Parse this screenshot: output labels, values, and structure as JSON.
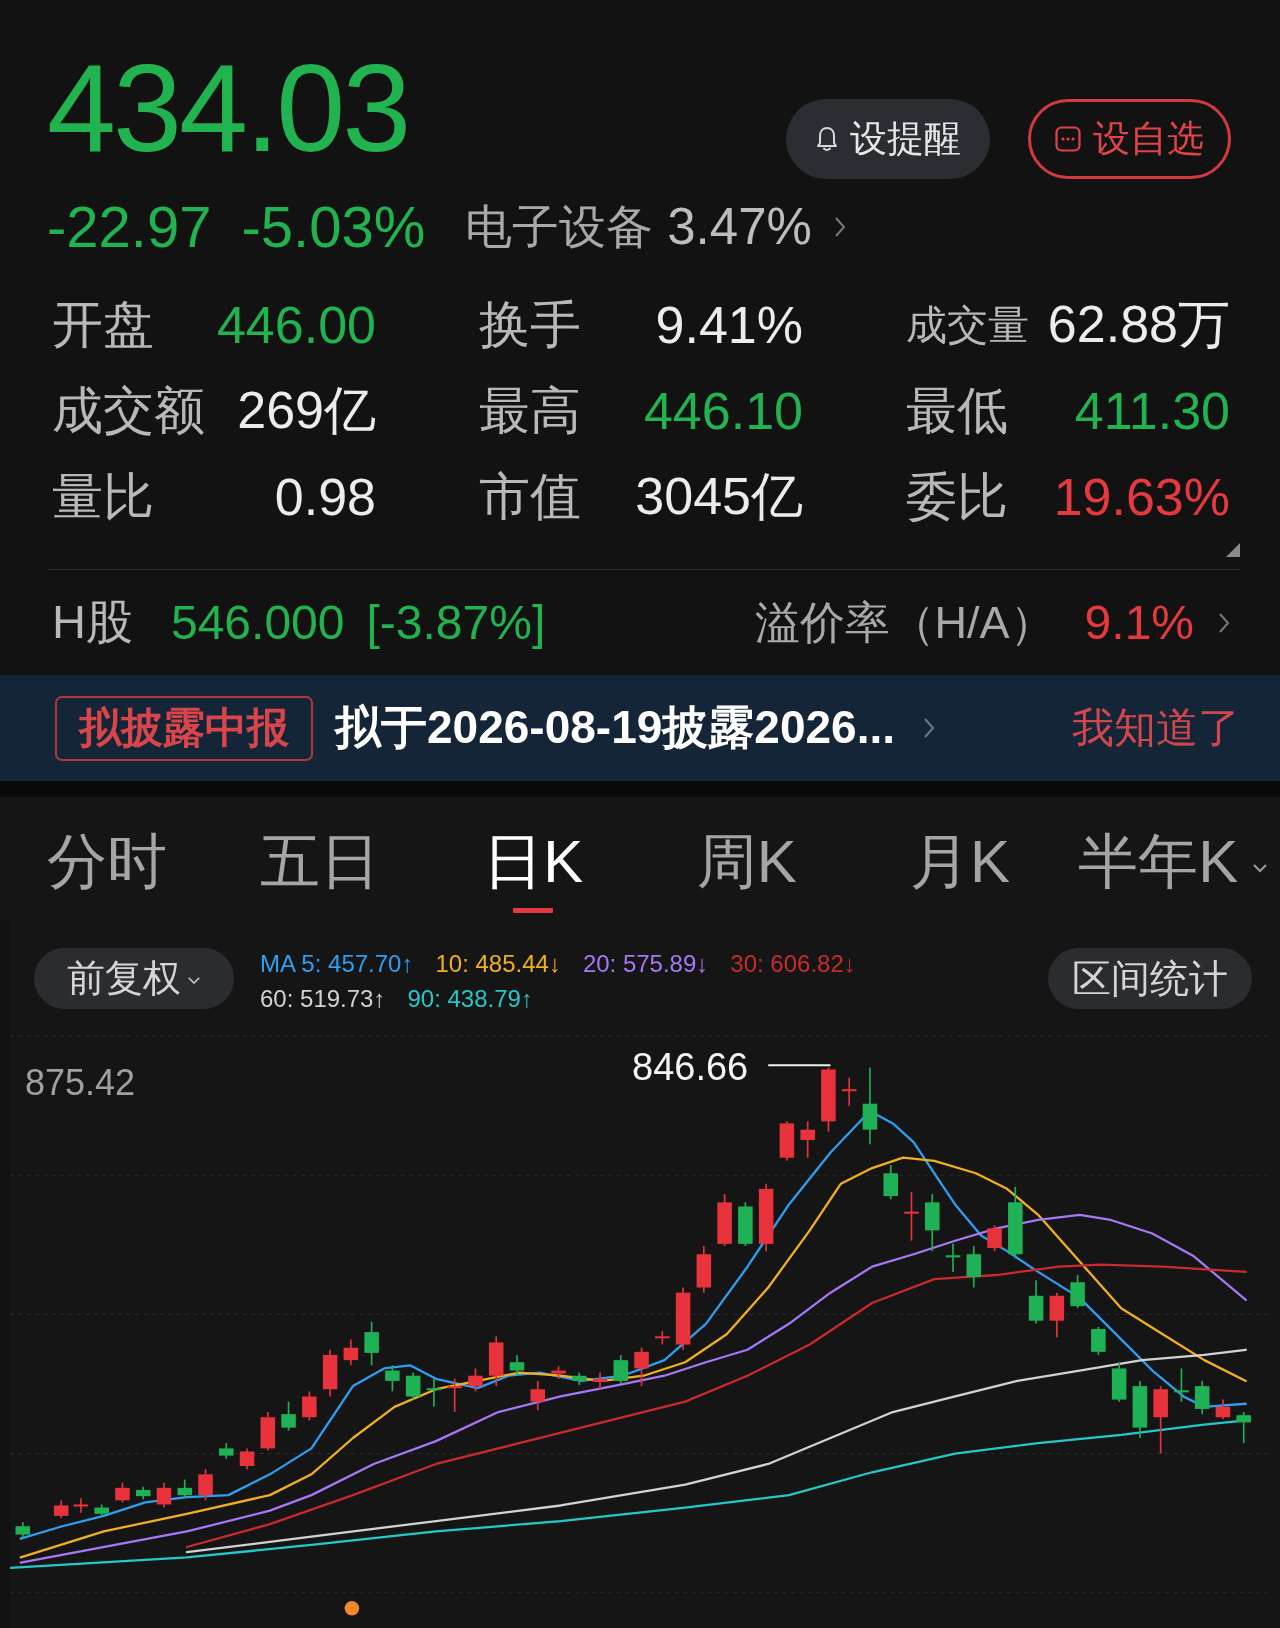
{
  "quote": {
    "price": "434.03",
    "change": "-22.97",
    "change_pct": "-5.03%",
    "falling": true
  },
  "sector": {
    "name": "电子设备",
    "change": "3.47%"
  },
  "actions": [
    {
      "kind": "alert",
      "label": "设提醒"
    },
    {
      "kind": "watchlist",
      "label": "设自选"
    }
  ],
  "stats": [
    [
      {
        "label": "开盘",
        "value": "446.00",
        "up": false,
        "down": true
      },
      {
        "label": "换手",
        "value": "9.41%",
        "up": false,
        "down": false
      },
      {
        "label": "成交量",
        "value": "62.88万",
        "up": false,
        "down": false
      }
    ],
    [
      {
        "label": "成交额",
        "value": "269亿",
        "up": false,
        "down": false
      },
      {
        "label": "最高",
        "value": "446.10",
        "up": false,
        "down": true
      },
      {
        "label": "最低",
        "value": "411.30",
        "up": false,
        "down": true
      }
    ],
    [
      {
        "label": "量比",
        "value": "0.98",
        "up": false,
        "down": false
      },
      {
        "label": "市值",
        "value": "3045亿",
        "up": false,
        "down": false
      },
      {
        "label": "委比",
        "value": "19.63%",
        "up": true,
        "down": false
      }
    ]
  ],
  "h_share": {
    "label": "H股",
    "price": "546.000",
    "change": "[-3.87%]",
    "falling": true
  },
  "premium": {
    "label": "溢价率（H/A）",
    "value": "9.1%",
    "falling": false
  },
  "notice": {
    "tag": "拟披露中报",
    "text": "拟于2026-08-19披露2026...",
    "dismiss": "我知道了"
  },
  "period_tabs": [
    {
      "label": "分时",
      "selected": false,
      "dropdown": false
    },
    {
      "label": "五日",
      "selected": false,
      "dropdown": false
    },
    {
      "label": "日K",
      "selected": true,
      "dropdown": false
    },
    {
      "label": "周K",
      "selected": false,
      "dropdown": false
    },
    {
      "label": "月K",
      "selected": false,
      "dropdown": false
    },
    {
      "label": "半年K",
      "selected": false,
      "dropdown": true
    }
  ],
  "chart_toolbar": {
    "adjust_menu": "前复权",
    "range_stats": "区间统计",
    "ma_legend": [
      [
        {
          "text": "MA 5: 457.70↑",
          "color": "#2e9ff2"
        },
        {
          "text": "10: 485.44↓",
          "color": "#f2b01e"
        },
        {
          "text": "20: 575.89↓",
          "color": "#a777f5"
        },
        {
          "text": "30: 606.82↓",
          "color": "#c82a2e"
        }
      ],
      [
        {
          "text": "60: 519.73↑",
          "color": "#d2d2d2"
        },
        {
          "text": "90: 438.79↑",
          "color": "#25c8c8"
        }
      ]
    ]
  },
  "chart": {
    "top_price": "875.42",
    "high_price": "846.66"
  }
}
